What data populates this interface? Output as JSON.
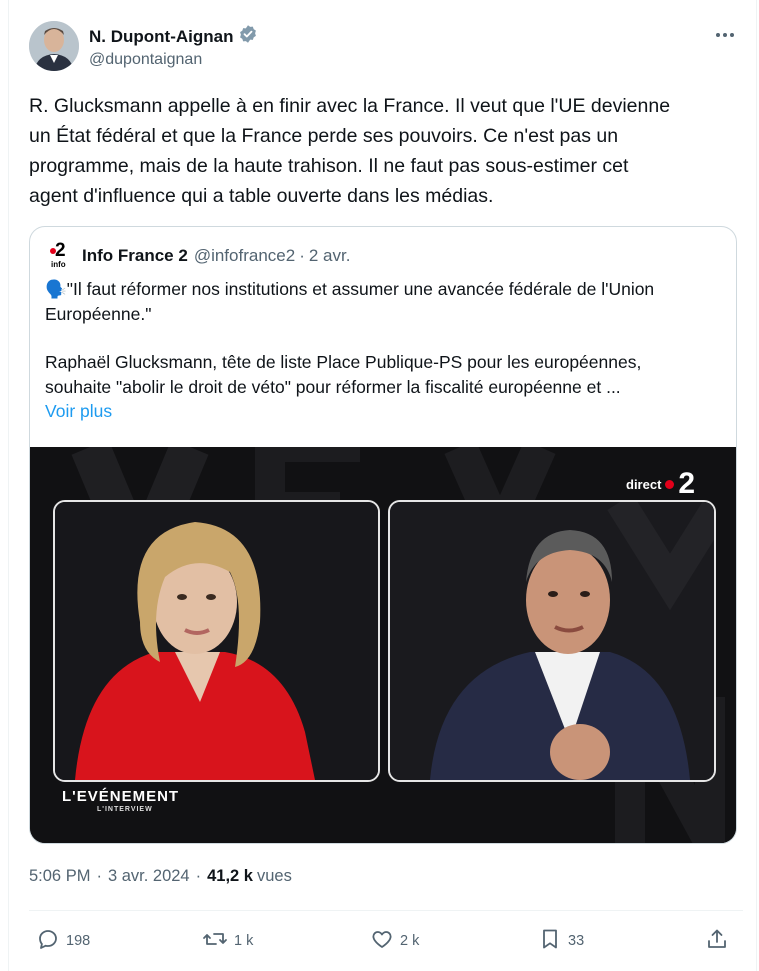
{
  "author": {
    "name": "N. Dupont-Aignan",
    "handle": "@dupontaignan",
    "verified": true,
    "verified_color": "#829aab"
  },
  "tweet": {
    "lines": [
      "R. Glucksmann appelle à en finir avec la France. Il veut que l'UE devienne",
      "un État fédéral et que la France perde ses pouvoirs. Ce n'est pas un",
      "programme, mais de la haute trahison. Il ne faut pas sous-estimer cet",
      "agent d'influence qui a table ouverte dans les médias."
    ]
  },
  "quote": {
    "logo_number": "2",
    "logo_word": "info",
    "name": "Info France 2",
    "handle": "@infofrance2",
    "separator": "·",
    "date": "2 avr.",
    "emoji": "🗣️",
    "text_lines_1": [
      "\"Il faut réformer nos institutions et assumer une avancée fédérale de l'Union",
      "Européenne.\""
    ],
    "text_lines_2": [
      "Raphaël Glucksmann, tête de liste Place Publique-PS pour les européennes,",
      "souhaite \"abolir le droit de véto\" pour réformer la fiscalité européenne et ..."
    ],
    "voir_plus": "Voir plus",
    "video": {
      "direct_label": "direct",
      "channel_number": "2",
      "show_title": "L'EVÉNEMENT",
      "show_subtitle": "L'INTERVIEW"
    }
  },
  "timestamp": {
    "time": "5:06 PM",
    "separator": "·",
    "date": "3 avr. 2024",
    "views_count": "41,2 k",
    "views_label": "vues"
  },
  "actions": {
    "replies": "198",
    "reposts": "1 k",
    "likes": "2 k",
    "bookmarks": "33"
  },
  "colors": {
    "link": "#1d9bf0",
    "secondary": "#536471",
    "primary": "#0f1419",
    "channel_red": "#e2001a"
  }
}
